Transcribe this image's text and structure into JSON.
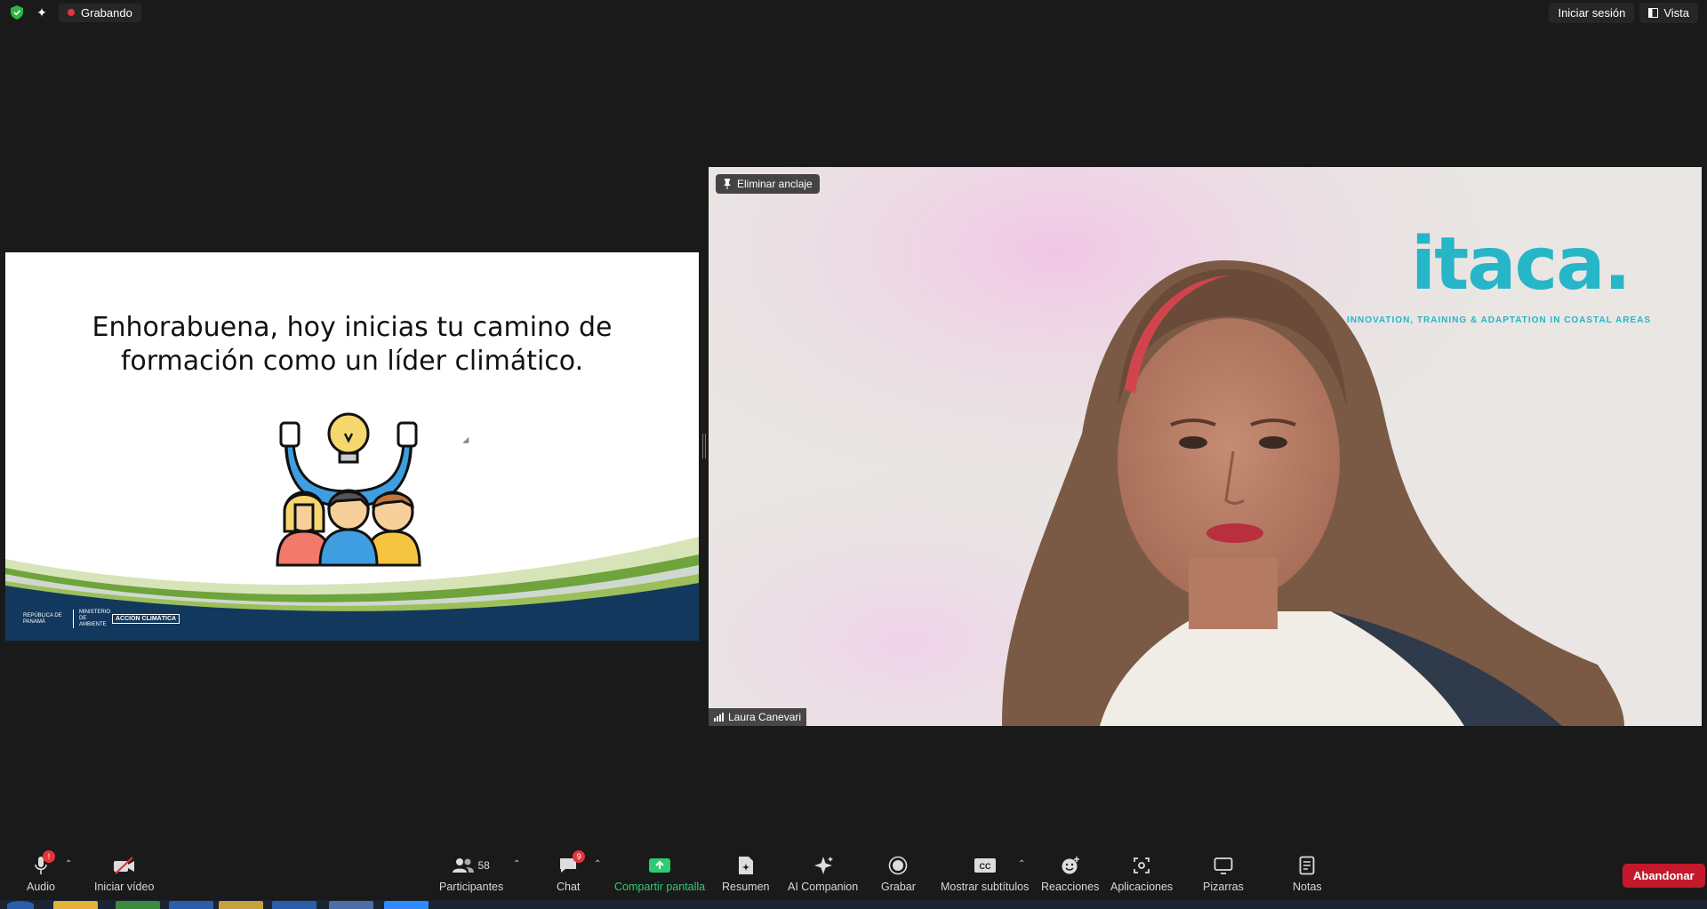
{
  "topbar": {
    "recording_label": "Grabando",
    "signin_label": "Iniciar sesión",
    "view_label": "Vista"
  },
  "slide": {
    "title_line1": "Enhorabuena, hoy inicias tu camino de",
    "title_line2": "formación como un líder climático.",
    "logo_text_1": "REPÚBLICA DE PANAMÁ",
    "logo_text_2": "MINISTERIO DE AMBIENTE",
    "logo_text_3": "ACCIÓN CLIMÁTICA"
  },
  "video": {
    "unpin_label": "Eliminar anclaje",
    "logo_text": "itaca.",
    "logo_subtitle": "INNOVATION, TRAINING & ADAPTATION  IN COASTAL AREAS",
    "participant_name": "Laura Canevari"
  },
  "toolbar": {
    "audio_label": "Audio",
    "audio_badge": "!",
    "video_label": "Iniciar vídeo",
    "participants_label": "Participantes",
    "participants_count": "58",
    "chat_label": "Chat",
    "chat_badge": "9",
    "share_label": "Compartir pantalla",
    "summary_label": "Resumen",
    "ai_label": "AI Companion",
    "record_label": "Grabar",
    "subtitles_label": "Mostrar subtítulos",
    "reactions_label": "Reacciones",
    "apps_label": "Aplicaciones",
    "whiteboards_label": "Pizarras",
    "notes_label": "Notas",
    "leave_label": "Abandonar"
  },
  "colors": {
    "accent_red": "#c4192b",
    "share_green": "#2ecc71",
    "itaca_teal": "#27b5c8"
  }
}
